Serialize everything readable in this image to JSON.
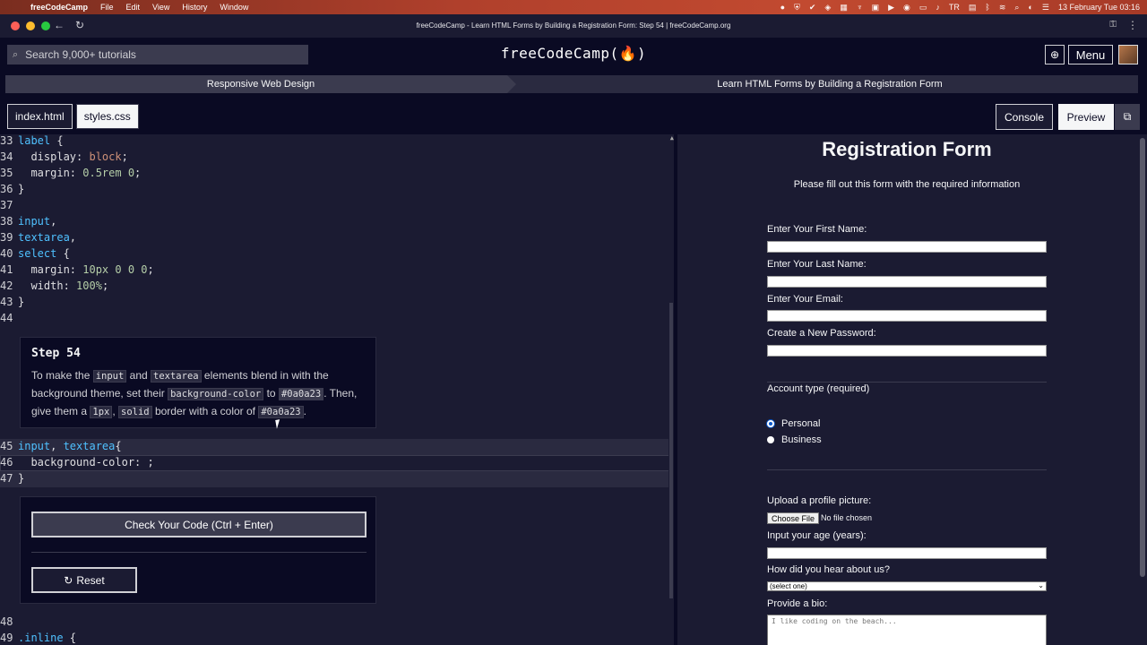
{
  "menubar": {
    "app_name": "freeCodeCamp",
    "items": [
      "File",
      "Edit",
      "View",
      "History",
      "Window"
    ],
    "datetime": "13 February Tue  03:16",
    "keyboard": "TR"
  },
  "window": {
    "title": "freeCodeCamp - Learn HTML Forms by Building a Registration Form: Step 54 | freeCodeCamp.org"
  },
  "header": {
    "search_placeholder": "Search 9,000+ tutorials",
    "brand": "freeCodeCamp(🔥)",
    "menu_label": "Menu"
  },
  "breadcrumb": {
    "course": "Responsive Web Design",
    "project": "Learn HTML Forms by Building a Registration Form"
  },
  "tabs": {
    "files": [
      "index.html",
      "styles.css"
    ],
    "active": "styles.css",
    "console_label": "Console",
    "preview_label": "Preview"
  },
  "editor": {
    "lines_before": [
      {
        "n": "33",
        "parts": [
          [
            "sel",
            "label"
          ],
          [
            "txt",
            " {"
          ]
        ]
      },
      {
        "n": "34",
        "parts": [
          [
            "prop",
            "  display"
          ],
          [
            "txt",
            ": "
          ],
          [
            "kw",
            "block"
          ],
          [
            "txt",
            ";"
          ]
        ]
      },
      {
        "n": "35",
        "parts": [
          [
            "prop",
            "  margin"
          ],
          [
            "txt",
            ": "
          ],
          [
            "num",
            "0.5rem 0"
          ],
          [
            "txt",
            ";"
          ]
        ]
      },
      {
        "n": "36",
        "parts": [
          [
            "txt",
            "}"
          ]
        ]
      },
      {
        "n": "37",
        "parts": []
      },
      {
        "n": "38",
        "parts": [
          [
            "sel",
            "input"
          ],
          [
            "txt",
            ","
          ]
        ]
      },
      {
        "n": "39",
        "parts": [
          [
            "sel",
            "textarea"
          ],
          [
            "txt",
            ","
          ]
        ]
      },
      {
        "n": "40",
        "parts": [
          [
            "sel",
            "select"
          ],
          [
            "txt",
            " {"
          ]
        ]
      },
      {
        "n": "41",
        "parts": [
          [
            "prop",
            "  margin"
          ],
          [
            "txt",
            ": "
          ],
          [
            "num",
            "10px 0 0 0"
          ],
          [
            "txt",
            ";"
          ]
        ]
      },
      {
        "n": "42",
        "parts": [
          [
            "prop",
            "  width"
          ],
          [
            "txt",
            ": "
          ],
          [
            "num",
            "100%"
          ],
          [
            "txt",
            ";"
          ]
        ]
      },
      {
        "n": "43",
        "parts": [
          [
            "txt",
            "}"
          ]
        ]
      },
      {
        "n": "44",
        "parts": []
      }
    ],
    "editable_lines": [
      {
        "n": "45",
        "parts": [
          [
            "sel",
            "input"
          ],
          [
            "txt",
            ", "
          ],
          [
            "sel",
            "textarea"
          ],
          [
            "txt",
            "{"
          ]
        ]
      },
      {
        "n": "46",
        "parts": [
          [
            "prop",
            "  background-color"
          ],
          [
            "txt",
            ": ;"
          ]
        ]
      },
      {
        "n": "47",
        "parts": [
          [
            "txt",
            "}"
          ]
        ]
      }
    ],
    "lines_after": [
      {
        "n": "48",
        "parts": []
      },
      {
        "n": "49",
        "parts": [
          [
            "sel",
            ".inline"
          ],
          [
            "txt",
            " {"
          ]
        ]
      }
    ]
  },
  "step": {
    "title": "Step 54",
    "t1": "To make the ",
    "c1": "input",
    "t2": " and ",
    "c2": "textarea",
    "t3": " elements blend in with the background theme, set their ",
    "c3": "background-color",
    "t4": " to ",
    "c4": "#0a0a23",
    "t5": ". Then, give them a ",
    "c5": "1px",
    "t6": ", ",
    "c6": "solid",
    "t7": " border with a color of ",
    "c7": "#0a0a23",
    "t8": "."
  },
  "actions": {
    "check_label": "Check Your Code (Ctrl + Enter)",
    "reset_label": "Reset"
  },
  "preview": {
    "title": "Registration Form",
    "subtitle": "Please fill out this form with the required information",
    "first_name": "Enter Your First Name:",
    "last_name": "Enter Your Last Name:",
    "email": "Enter Your Email:",
    "password": "Create a New Password:",
    "account_type": "Account type (required)",
    "personal": "Personal",
    "business": "Business",
    "upload": "Upload a profile picture:",
    "choose_file": "Choose File",
    "no_file": "No file chosen",
    "age": "Input your age (years):",
    "hear": "How did you hear about us?",
    "select_value": "(select one)",
    "bio": "Provide a bio:",
    "bio_placeholder": "I like coding on the beach..."
  }
}
